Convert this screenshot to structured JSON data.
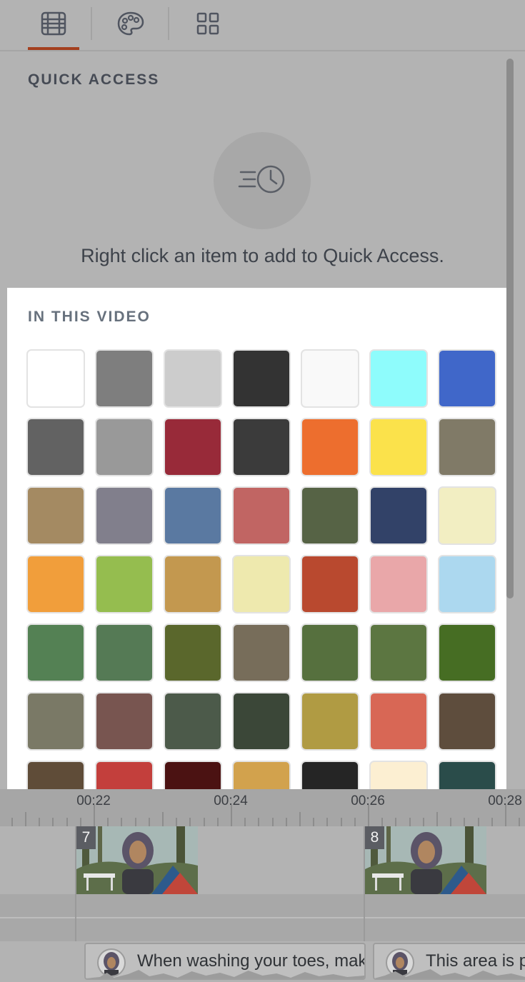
{
  "tabs": [
    {
      "name": "scenes-tab",
      "icon": "film-grid-icon",
      "active": true
    },
    {
      "name": "palette-tab",
      "icon": "palette-icon",
      "active": false
    },
    {
      "name": "grid-tab",
      "icon": "grid-icon",
      "active": false
    }
  ],
  "accent_color": "#a4401f",
  "quick_access": {
    "title": "QUICK ACCESS",
    "icon": "recent-history-icon",
    "hint": "Right click an item to add to Quick Access."
  },
  "in_this_video": {
    "title": "IN THIS VIDEO",
    "swatches": [
      "#ffffff",
      "#7e7e7e",
      "#cccccc",
      "#333333",
      "#f9f9f9",
      "#8efcfc",
      "#4067c9",
      "#626262",
      "#999999",
      "#982a39",
      "#3b3b3b",
      "#ed6e2e",
      "#fbe24b",
      "#807a67",
      "#a48a62",
      "#817f8c",
      "#5a79a1",
      "#c16563",
      "#566345",
      "#324268",
      "#f2eec2",
      "#f19e3b",
      "#95bd4f",
      "#c3984f",
      "#eee9ae",
      "#b9492f",
      "#e9a7a9",
      "#acd8ef",
      "#548154",
      "#557a55",
      "#5a672c",
      "#776d5a",
      "#56703e",
      "#5c7641",
      "#466d23",
      "#7a7966",
      "#785550",
      "#4c5a4a",
      "#3b4738",
      "#b09b43",
      "#d86755",
      "#5e4d3d",
      "#5f4c38",
      "#c33f3c",
      "#4b1212",
      "#d2a24d",
      "#252525",
      "#fcefd2",
      "#2a4c4a"
    ]
  },
  "timeline": {
    "labels": [
      "00:22",
      "00:24",
      "00:26",
      "00:28"
    ],
    "scenes": [
      {
        "number": "7"
      },
      {
        "number": "8"
      }
    ],
    "captions": [
      {
        "text": "When washing your toes, make"
      },
      {
        "text": "This area is pr"
      }
    ]
  }
}
